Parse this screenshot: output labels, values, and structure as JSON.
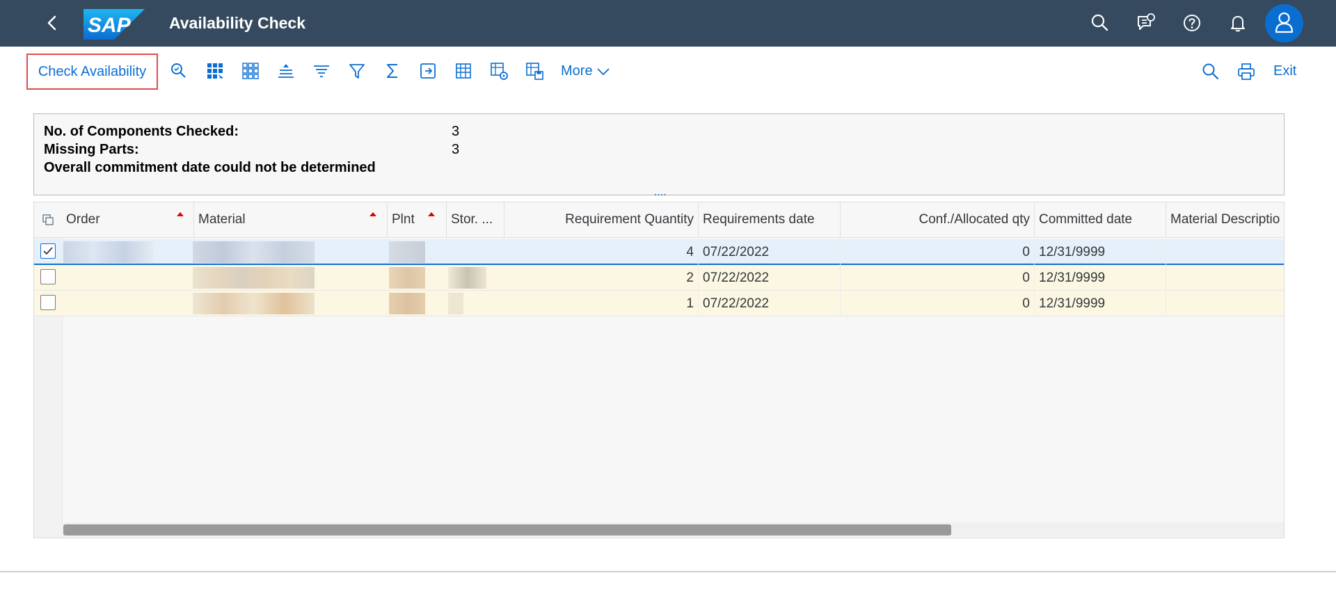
{
  "shell": {
    "title": "Availability Check",
    "logo_text": "SAP",
    "icons": [
      "back-icon",
      "search-icon",
      "feedback-icon",
      "help-icon",
      "notification-bell-icon",
      "user-avatar-icon"
    ]
  },
  "toolbar": {
    "check_availability_label": "Check Availability",
    "more_label": "More",
    "exit_label": "Exit",
    "icons": [
      "detail-magnifier-icon",
      "select-all-icon",
      "deselect-all-icon",
      "sort-ascending-icon",
      "sort-descending-icon",
      "filter-icon",
      "sum-icon",
      "export-icon",
      "layout-grid-icon",
      "layout-settings-icon",
      "save-layout-icon",
      "search-icon",
      "print-icon"
    ]
  },
  "summary": {
    "components_label": "No. of Components Checked:",
    "components_value": "3",
    "missing_label": "Missing Parts:",
    "missing_value": "3",
    "commitment_text": "Overall commitment date could not be determined"
  },
  "table": {
    "columns": {
      "order": "Order",
      "material": "Material",
      "plnt": "Plnt",
      "stor": "Stor. ...",
      "req_qty": "Requirement Quantity",
      "req_date": "Requirements date",
      "conf_qty": "Conf./Allocated qty",
      "committed_date": "Committed date",
      "mat_desc": "Material Descriptio"
    },
    "rows": [
      {
        "req_qty": "4",
        "req_date": "07/22/2022",
        "conf_qty": "0",
        "committed_date": "12/31/9999",
        "selected": true
      },
      {
        "req_qty": "2",
        "req_date": "07/22/2022",
        "conf_qty": "0",
        "committed_date": "12/31/9999",
        "selected": false
      },
      {
        "req_qty": "1",
        "req_date": "07/22/2022",
        "conf_qty": "0",
        "committed_date": "12/31/9999",
        "selected": false
      }
    ]
  },
  "colors": {
    "shell_bg": "#354a5f",
    "accent": "#0a6ed1",
    "highlight_border": "#e34a4a",
    "selected_row": "#e5f0fa",
    "warning_row": "#fcf7e2"
  }
}
